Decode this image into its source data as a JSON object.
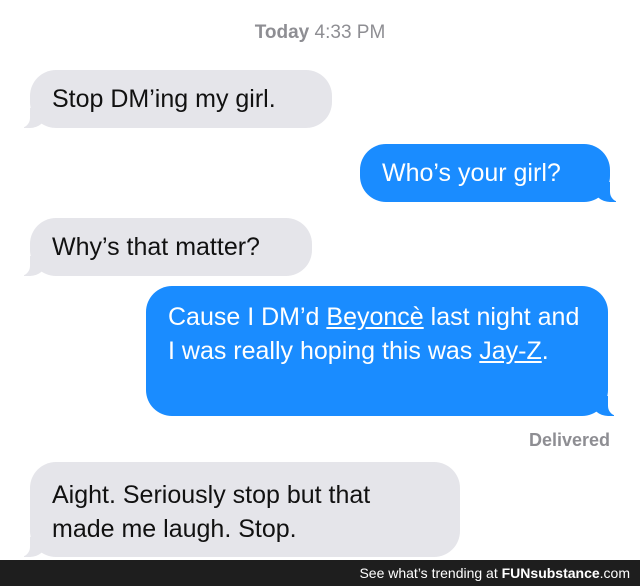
{
  "header": {
    "day": "Today",
    "time": "4:33 PM"
  },
  "messages": [
    {
      "direction": "in",
      "text": "Stop DM’ing my girl."
    },
    {
      "direction": "out",
      "text": "Who’s your girl?"
    },
    {
      "direction": "in",
      "text": "Why’s that matter?"
    },
    {
      "direction": "out",
      "parts": [
        "Cause I DM’d ",
        "Beyoncè",
        " last night and I was really hoping this was ",
        "Jay-Z",
        "."
      ]
    },
    {
      "direction": "in",
      "text": "Aight. Seriously stop but that made me laugh. Stop."
    }
  ],
  "status": {
    "delivered": "Delivered"
  },
  "footer": {
    "text": "See what’s trending at",
    "brand_a": "FUN",
    "brand_b": "substance",
    "brand_c": ".com"
  },
  "colors": {
    "incoming_bubble": "#e5e5ea",
    "outgoing_bubble": "#1a8cff",
    "meta_text": "#8e8e93"
  }
}
